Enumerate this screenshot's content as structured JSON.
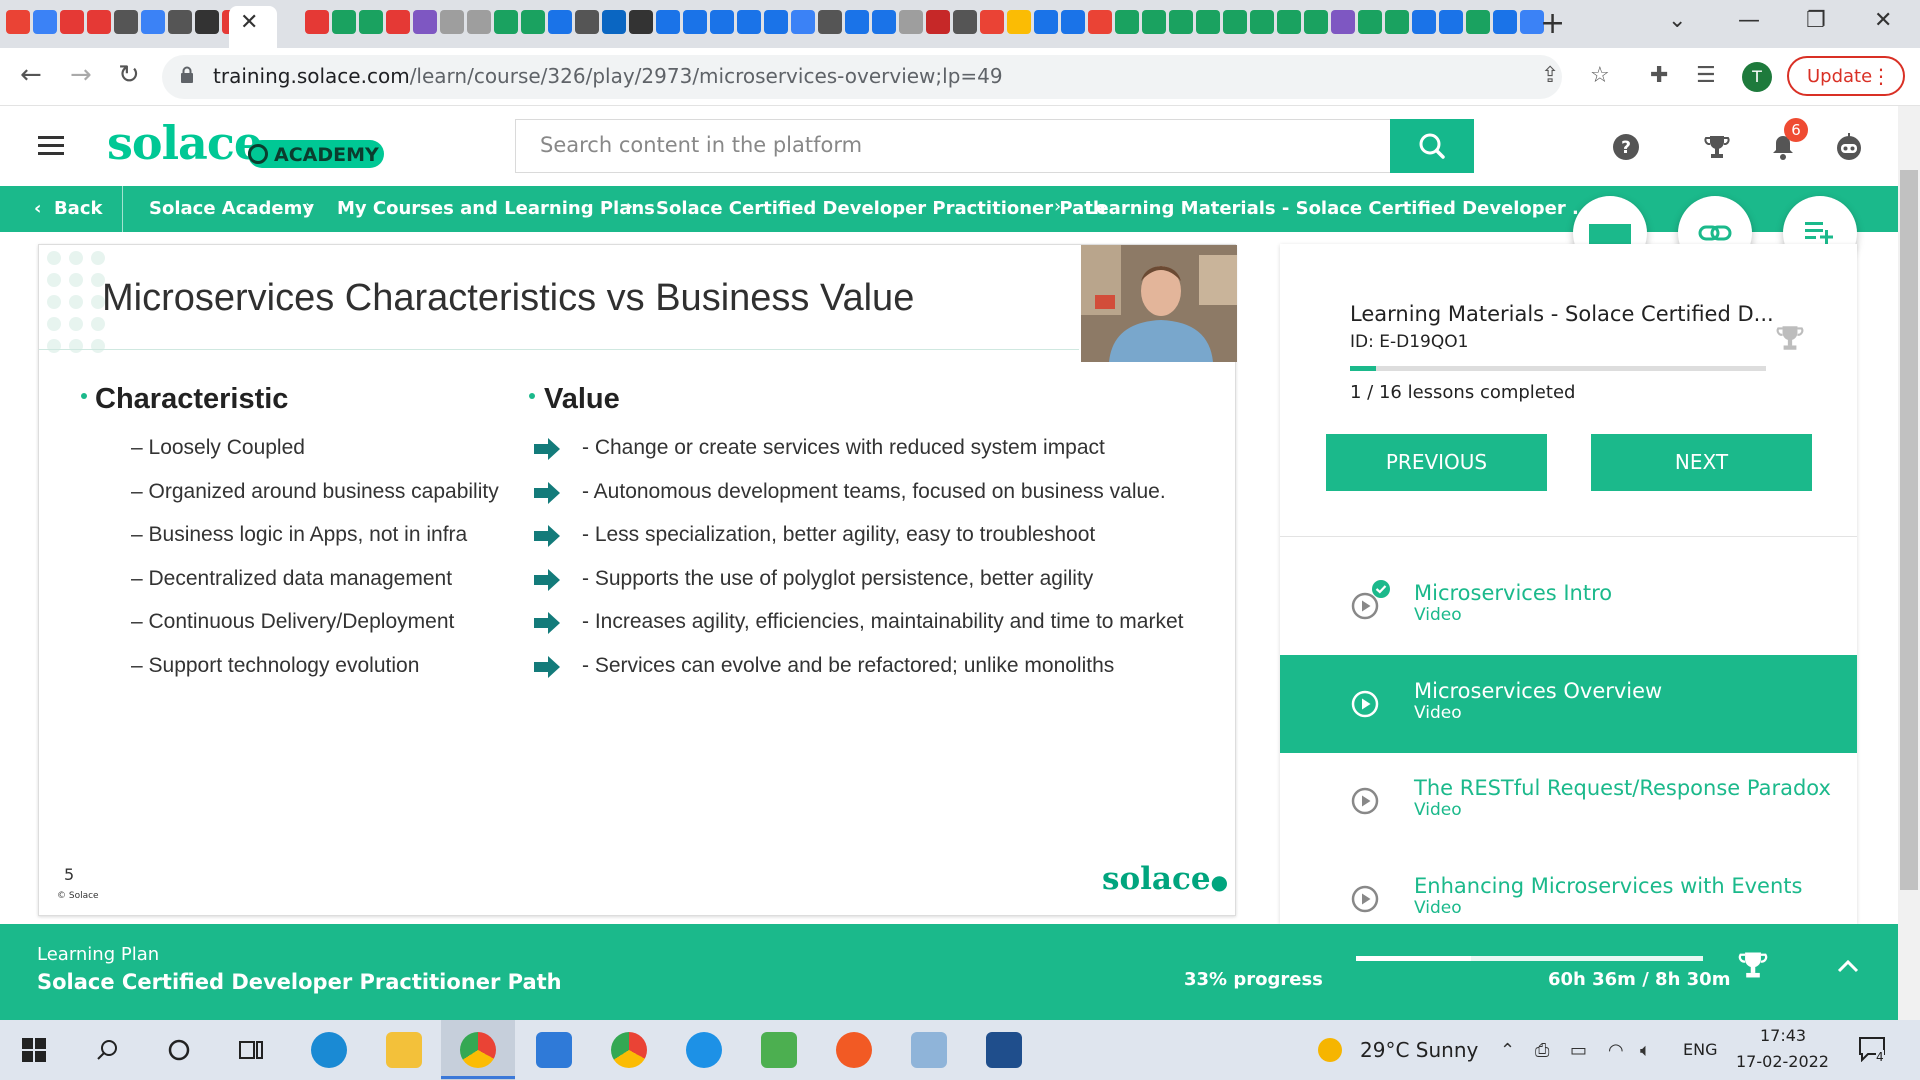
{
  "browser": {
    "url_host": "training.solace.com",
    "url_path": "/learn/course/326/play/2973/microservices-overview;lp=49",
    "update_label": "Update",
    "profile_initial": "T",
    "tab_favicon_colors": [
      "#ea4335",
      "#3b82f6",
      "#e53935",
      "#e53935",
      "#555555",
      "#3b82f6",
      "#555555",
      "#333333",
      "#e53935",
      "#e53935",
      "#1aa260",
      "#1aa260",
      "#e53935",
      "#7e57c2",
      "#9e9e9e",
      "#9e9e9e",
      "#1aa260",
      "#1aa260",
      "#1a73e8",
      "#555555",
      "#0a66c2",
      "#333333",
      "#1a73e8",
      "#1a73e8",
      "#1a73e8",
      "#1a73e8",
      "#1a73e8",
      "#3b82f6",
      "#555555",
      "#1a73e8",
      "#1a73e8",
      "#9e9e9e",
      "#c62828",
      "#555555",
      "#ea4335",
      "#fbbc04",
      "#1a73e8",
      "#1a73e8",
      "#ea4335",
      "#1aa260",
      "#1aa260",
      "#1aa260",
      "#1aa260",
      "#1aa260",
      "#1aa260",
      "#1aa260",
      "#1aa260",
      "#7e57c2",
      "#1aa260",
      "#1aa260",
      "#1a73e8",
      "#1a73e8",
      "#1aa260",
      "#1a73e8",
      "#3b82f6"
    ]
  },
  "header": {
    "logo_text": "solace",
    "logo_badge": "ACADEMY",
    "search_placeholder": "Search content in the platform",
    "notification_count": "6",
    "brand_color": "#1bb98b"
  },
  "breadcrumb": {
    "back_label": "Back",
    "items": [
      {
        "label": "Solace Academy"
      },
      {
        "label": "My Courses and Learning Plans"
      },
      {
        "label": "Solace Certified Developer Practitioner Path"
      },
      {
        "label": "Learning Materials - Solace Certified Developer ..."
      }
    ]
  },
  "slide": {
    "title": "Microservices Characteristics vs Business Value",
    "characteristic_heading": "Characteristic",
    "value_heading": "Value",
    "rows": [
      {
        "characteristic": "– Loosely Coupled",
        "value": "- Change or create services with reduced system impact"
      },
      {
        "characteristic": "– Organized around business capability",
        "value": "- Autonomous development teams, focused on business value."
      },
      {
        "characteristic": "– Business logic in Apps, not in infra",
        "value": "- Less specialization, better agility, easy to troubleshoot"
      },
      {
        "characteristic": "– Decentralized data management",
        "value": "- Supports the use of polyglot persistence, better agility"
      },
      {
        "characteristic": "– Continuous Delivery/Deployment",
        "value": "- Increases agility, efficiencies, maintainability and time to market"
      },
      {
        "characteristic": "– Support technology evolution",
        "value": "- Services can evolve and be refactored; unlike monoliths"
      }
    ],
    "page_number": "5",
    "copyright": "© Solace",
    "footer_logo": "solace"
  },
  "panel": {
    "title": "Learning Materials - Solace Certified D...",
    "id": "ID: E-D19QO1",
    "lessons_completed": "1 / 16 lessons completed",
    "progress_fraction": 0.0625,
    "previous_label": "PREVIOUS",
    "next_label": "NEXT",
    "lessons": [
      {
        "title": "Microservices Intro",
        "type": "Video",
        "completed": true,
        "active": false
      },
      {
        "title": "Microservices Overview",
        "type": "Video",
        "completed": false,
        "active": true
      },
      {
        "title": "The RESTful Request/Response Paradox",
        "type": "Video",
        "completed": false,
        "active": false
      },
      {
        "title": "Enhancing Microservices with Events",
        "type": "Video",
        "completed": false,
        "active": false
      }
    ]
  },
  "learning_plan": {
    "label": "Learning Plan",
    "name": "Solace Certified Developer Practitioner Path",
    "progress_label": "33% progress",
    "progress_fraction": 0.33,
    "time_label": "60h 36m / 8h 30m"
  },
  "taskbar": {
    "weather": "29°C  Sunny",
    "language": "ENG",
    "time": "17:43",
    "date": "17-02-2022",
    "notification_count": "4"
  }
}
